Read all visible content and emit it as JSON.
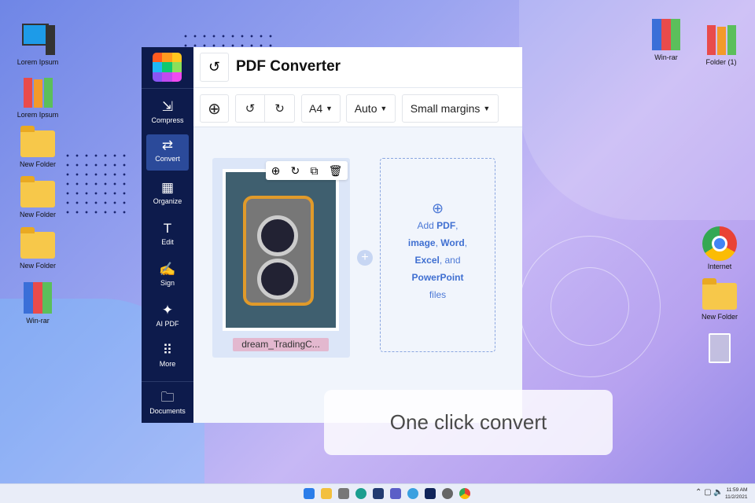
{
  "desktop": {
    "left_icons": [
      "Lorem Ipsum",
      "Lorem Ipsum",
      "New Folder",
      "New Folder",
      "New Folder",
      "Win-rar"
    ],
    "right_icons": [
      "Win-rar",
      "Folder (1)",
      "Internet",
      "New Folder"
    ]
  },
  "app": {
    "title": "PDF Converter",
    "sidebar": [
      {
        "label": "Compress",
        "icon": "compress-icon"
      },
      {
        "label": "Convert",
        "icon": "convert-icon"
      },
      {
        "label": "Organize",
        "icon": "grid-icon"
      },
      {
        "label": "Edit",
        "icon": "text-icon"
      },
      {
        "label": "Sign",
        "icon": "signature-icon"
      },
      {
        "label": "AI PDF",
        "icon": "sparkle-icon"
      },
      {
        "label": "More",
        "icon": "dots-icon"
      },
      {
        "label": "Documents",
        "icon": "folder-icon"
      }
    ],
    "toolbar": {
      "page_size": "A4",
      "orientation": "Auto",
      "margins": "Small margins"
    },
    "file": {
      "name": "dream_TradingC..."
    },
    "drop": {
      "add": "Add",
      "pdf": "PDF",
      "image": "image",
      "word": "Word",
      "excel": "Excel",
      "and": ", and",
      "powerpoint": "PowerPoint",
      "files": "files"
    }
  },
  "banner": "One click convert",
  "taskbar": {
    "time": "11:59 AM",
    "date": "11/2/2021"
  },
  "colors": {
    "sidebar": "#0d1b4c",
    "accent": "#3f6fd1"
  }
}
